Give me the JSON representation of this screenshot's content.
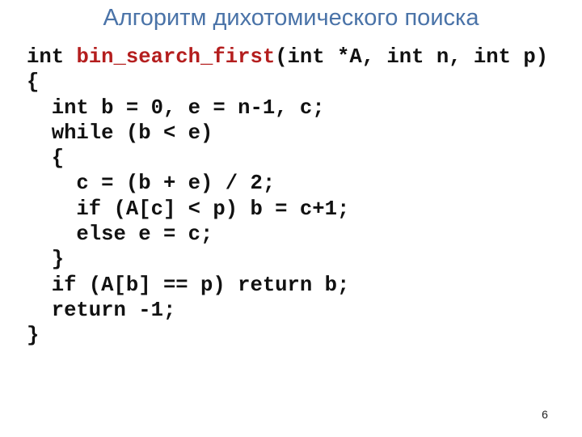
{
  "slide": {
    "title": "Алгоритм дихотомического поиска",
    "page_number": "6",
    "colors": {
      "title": "#4a73a8",
      "code": "#111111",
      "function_name": "#b41e1e",
      "background": "#ffffff"
    },
    "code": {
      "signature": {
        "return_type": "int ",
        "function_name": "bin_search_first",
        "params": "(int *A, int n, int p)"
      },
      "lines": [
        "{",
        "  int b = 0, e = n-1, c;",
        "  while (b < e)",
        "  {",
        "    c = (b + e) / 2;",
        "    if (A[c] < p) b = c+1;",
        "    else e = c;",
        "  }",
        "  if (A[b] == p) return b;",
        "  return -1;",
        "}"
      ]
    }
  }
}
